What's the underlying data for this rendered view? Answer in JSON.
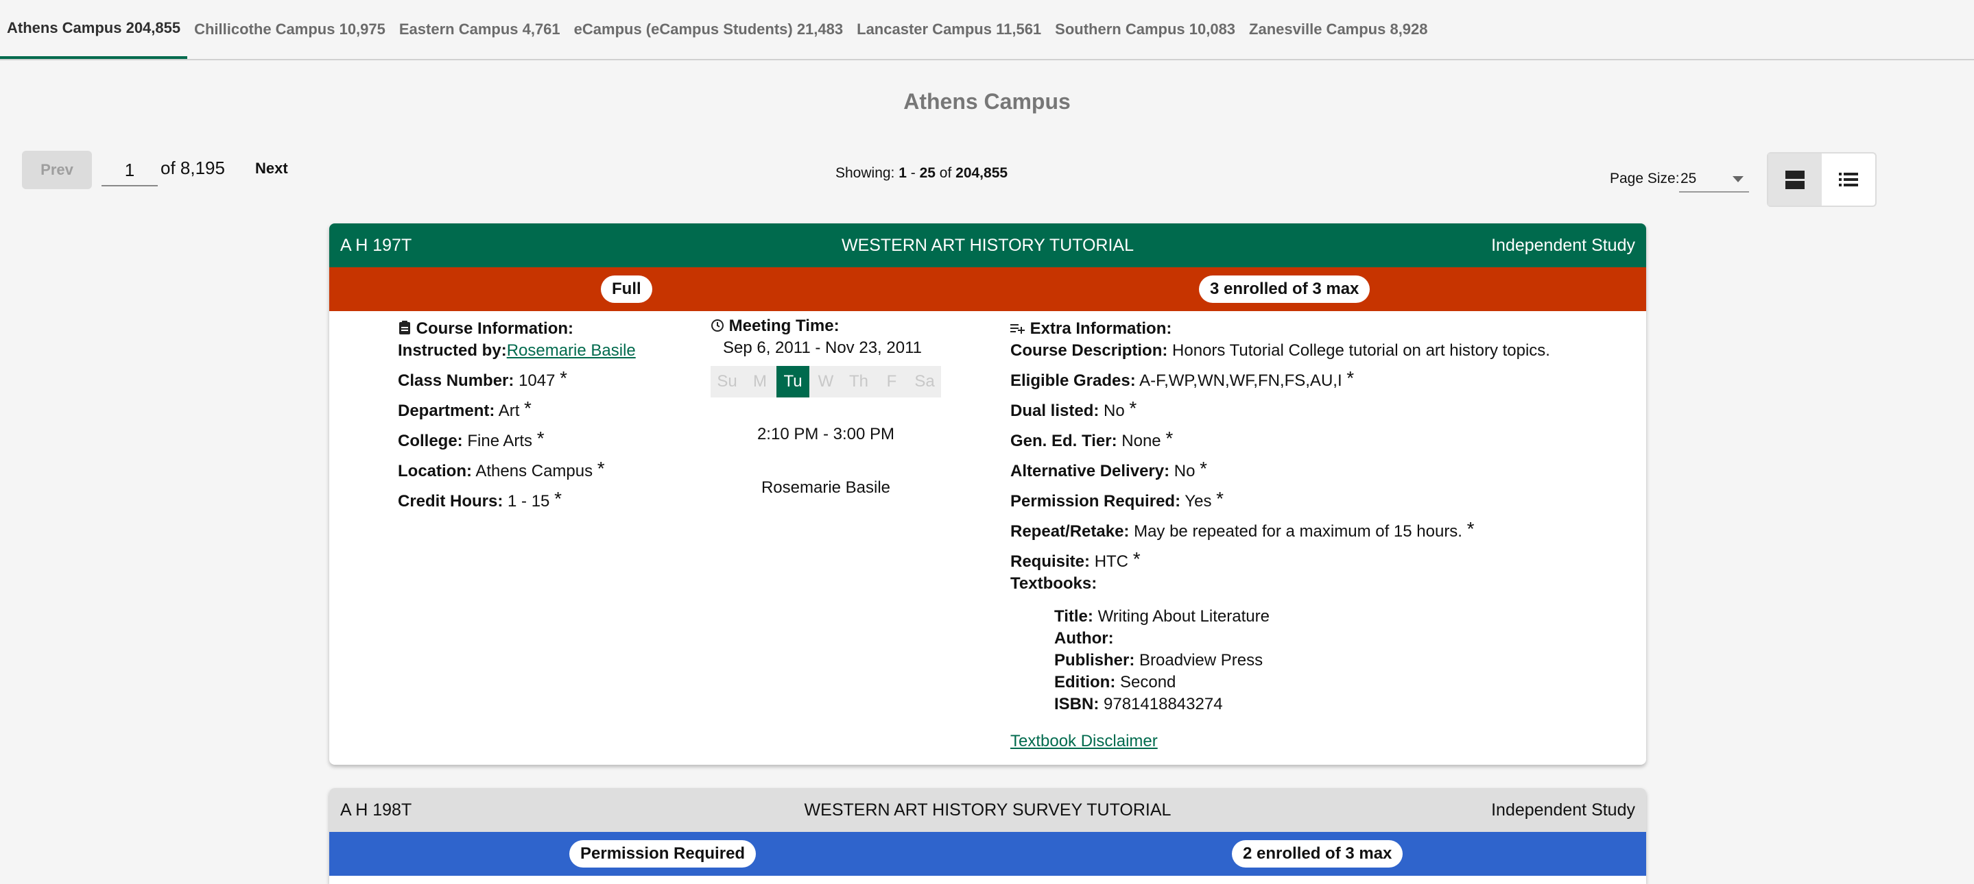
{
  "tabs": [
    {
      "label": "Athens Campus 204,855",
      "active": true
    },
    {
      "label": "Chillicothe Campus 10,975"
    },
    {
      "label": "Eastern Campus 4,761"
    },
    {
      "label": "eCampus (eCampus Students) 21,483"
    },
    {
      "label": "Lancaster Campus 11,561"
    },
    {
      "label": "Southern Campus 10,083"
    },
    {
      "label": "Zanesville Campus 8,928"
    }
  ],
  "page_title": "Athens Campus",
  "pager": {
    "prev_label": "Prev",
    "current_page": "1",
    "of_label": "of 8,195",
    "next_label": "Next",
    "showing_prefix": "Showing: ",
    "showing_from": "1",
    "showing_dash": " - ",
    "showing_to": "25",
    "showing_of": " of ",
    "showing_total": "204,855",
    "page_size_label": "Page Size:",
    "page_size_value": "25"
  },
  "colors": {
    "brand": "#006a4d",
    "full": "#c73400",
    "permission": "#2f64cc"
  },
  "course1": {
    "code": "A H 197T",
    "title": "WESTERN ART HISTORY TUTORIAL",
    "type": "Independent Study",
    "status": "Full",
    "enrollment": "3 enrolled of 3 max",
    "course_info_heading": "Course Information:",
    "instructed_by_label": "Instructed by:",
    "instructor": "Rosemarie Basile",
    "class_number_label": "Class Number:",
    "class_number": "1047",
    "department_label": "Department:",
    "department": "Art",
    "college_label": "College:",
    "college": "Fine Arts",
    "location_label": "Location:",
    "location": "Athens Campus",
    "credit_hours_label": "Credit Hours:",
    "credit_hours": "1 - 15",
    "star": "*",
    "meeting_heading": "Meeting Time:",
    "date_range": "Sep 6, 2011 - Nov 23, 2011",
    "days": [
      "Su",
      "M",
      "Tu",
      "W",
      "Th",
      "F",
      "Sa"
    ],
    "active_day": "Tu",
    "time": "2:10 PM - 3:00 PM",
    "meeting_instructor": "Rosemarie Basile",
    "extra_heading": "Extra Information:",
    "description_label": "Course Description:",
    "description": "Honors Tutorial College tutorial on art history topics.",
    "grades_label": "Eligible Grades:",
    "grades": "A-F,WP,WN,WF,FN,FS,AU,I",
    "dual_label": "Dual listed:",
    "dual": "No",
    "gened_label": "Gen. Ed. Tier:",
    "gened": "None",
    "altdelivery_label": "Alternative Delivery:",
    "altdelivery": "No",
    "permission_label": "Permission Required:",
    "permission": "Yes",
    "repeat_label": "Repeat/Retake:",
    "repeat": "May be repeated for a maximum of 15 hours.",
    "requisite_label": "Requisite:",
    "requisite": "HTC",
    "textbooks_label": "Textbooks:",
    "tb_title_label": "Title:",
    "tb_title": "Writing About Literature",
    "tb_author_label": "Author:",
    "tb_author": "",
    "tb_publisher_label": "Publisher:",
    "tb_publisher": "Broadview Press",
    "tb_edition_label": "Edition:",
    "tb_edition": "Second",
    "tb_isbn_label": "ISBN:",
    "tb_isbn": "9781418843274",
    "disclaimer": "Textbook Disclaimer"
  },
  "course2": {
    "code": "A H 198T",
    "title": "WESTERN ART HISTORY SURVEY TUTORIAL",
    "type": "Independent Study",
    "status": "Permission Required",
    "enrollment": "2 enrolled of 3 max"
  }
}
